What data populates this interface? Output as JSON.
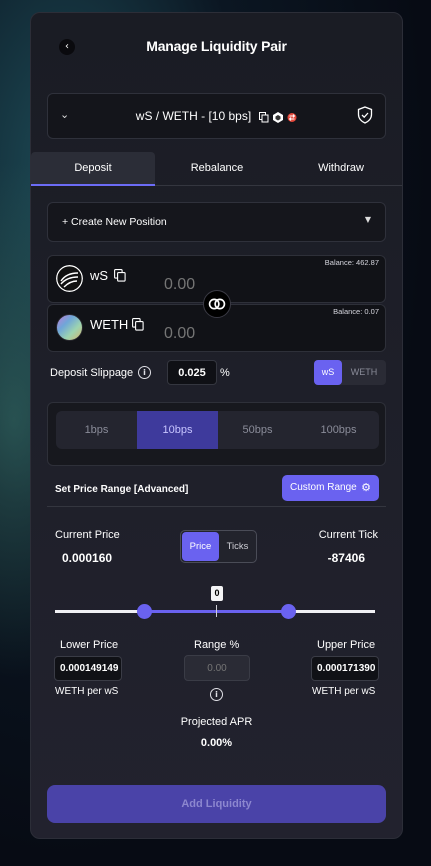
{
  "header": {
    "title": "Manage Liquidity Pair",
    "back_icon": "‹"
  },
  "pair": {
    "label": "wS / WETH - [10 bps]",
    "chevron": "⌄"
  },
  "tabs": [
    {
      "label": "Deposit",
      "active": true
    },
    {
      "label": "Rebalance",
      "active": false
    },
    {
      "label": "Withdraw",
      "active": false
    }
  ],
  "position_select": {
    "label": "+ Create New Position",
    "arrow": "▼"
  },
  "tokens": [
    {
      "symbol": "wS",
      "balance": "Balance: 462.87",
      "amount_placeholder": "0.00"
    },
    {
      "symbol": "WETH",
      "balance": "Balance: 0.07",
      "amount_placeholder": "0.00"
    }
  ],
  "slippage": {
    "label": "Deposit Slippage",
    "value": "0.025",
    "unit": "%",
    "info": "i"
  },
  "deposit_token_toggle": {
    "options": [
      "wS",
      "WETH"
    ],
    "selected": "wS"
  },
  "fee_tiers": {
    "options": [
      "1bps",
      "10bps",
      "50bps",
      "100bps"
    ],
    "selected": "10bps"
  },
  "price_range": {
    "title": "Set Price Range [Advanced]",
    "custom_button": "Custom Range",
    "gear": "⚙"
  },
  "current": {
    "price_label": "Current Price",
    "price_value": "0.000160",
    "tick_label": "Current Tick",
    "tick_value": "-87406"
  },
  "price_tick_toggle": {
    "options": [
      "Price",
      "Ticks"
    ],
    "selected": "Price"
  },
  "slider": {
    "tick_offset_label": "0",
    "lower_fraction": 0.28,
    "upper_fraction": 0.73
  },
  "lower": {
    "label": "Lower Price",
    "value": "0.000149149",
    "unit": "WETH per wS"
  },
  "range_pct": {
    "label": "Range %",
    "placeholder": "0.00",
    "info": "i"
  },
  "upper": {
    "label": "Upper Price",
    "value": "0.000171390",
    "unit": "WETH per wS"
  },
  "apr": {
    "label": "Projected APR",
    "value": "0.00%"
  },
  "submit": {
    "label": "Add Liquidity"
  },
  "colors": {
    "accent": "#6a62f0",
    "panel": "#1e1f29",
    "button_disabled": "#4a43a8"
  }
}
